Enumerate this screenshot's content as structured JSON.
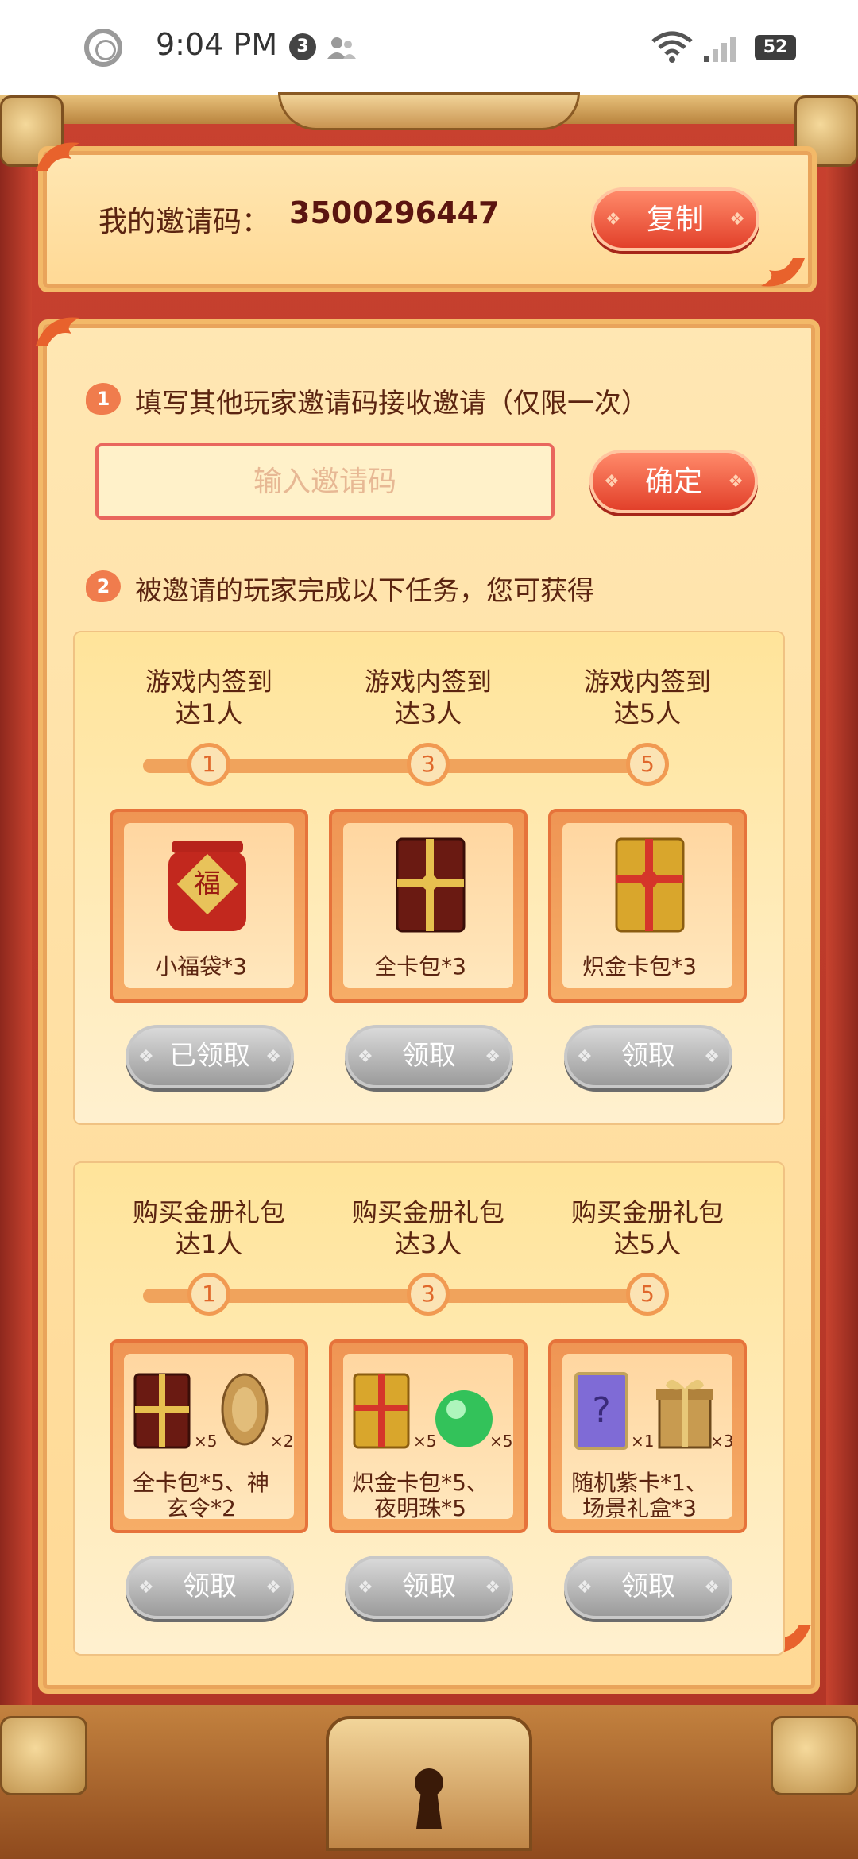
{
  "status_bar": {
    "time": "9:04 PM",
    "notification_count": "3",
    "battery": "52",
    "icons": [
      "circle-icon",
      "person-icon",
      "wifi-icon",
      "signal-icon",
      "battery-icon"
    ]
  },
  "invite": {
    "label": "我的邀请码：",
    "code": "3500296447",
    "copy_label": "复制"
  },
  "step1": {
    "number": "1",
    "text": "填写其他玩家邀请码接收邀请（仅限一次）",
    "input_placeholder": "输入邀请码",
    "input_value": "",
    "confirm_label": "确定"
  },
  "step2": {
    "number": "2",
    "text": "被邀请的玩家完成以下任务，您可获得"
  },
  "task_groups": [
    {
      "milestones": [
        {
          "title": "游戏内签到",
          "target": "达1人",
          "node": "1",
          "reward": "小福袋*3",
          "button": "已领取"
        },
        {
          "title": "游戏内签到",
          "target": "达3人",
          "node": "3",
          "reward": "全卡包*3",
          "button": "领取"
        },
        {
          "title": "游戏内签到",
          "target": "达5人",
          "node": "5",
          "reward": "炽金卡包*3",
          "button": "领取"
        }
      ]
    },
    {
      "milestones": [
        {
          "title": "购买金册礼包",
          "target": "达1人",
          "node": "1",
          "reward_line1": "全卡包*5、神",
          "reward_line2": "玄令*2",
          "qty_a": "×5",
          "qty_b": "×2",
          "button": "领取"
        },
        {
          "title": "购买金册礼包",
          "target": "达3人",
          "node": "3",
          "reward_line1": "炽金卡包*5、",
          "reward_line2": "夜明珠*5",
          "qty_a": "×5",
          "qty_b": "×5",
          "button": "领取"
        },
        {
          "title": "购买金册礼包",
          "target": "达5人",
          "node": "5",
          "reward_line1": "随机紫卡*1、",
          "reward_line2": "场景礼盒*3",
          "qty_a": "×1",
          "qty_b": "×3",
          "button": "领取"
        }
      ]
    }
  ],
  "colors": {
    "frame_red": "#c8412f",
    "panel_cream": "#ffe7b3",
    "button_red": "#e2402a",
    "button_gray": "#9b9b9b",
    "text_brown": "#5b2410"
  }
}
